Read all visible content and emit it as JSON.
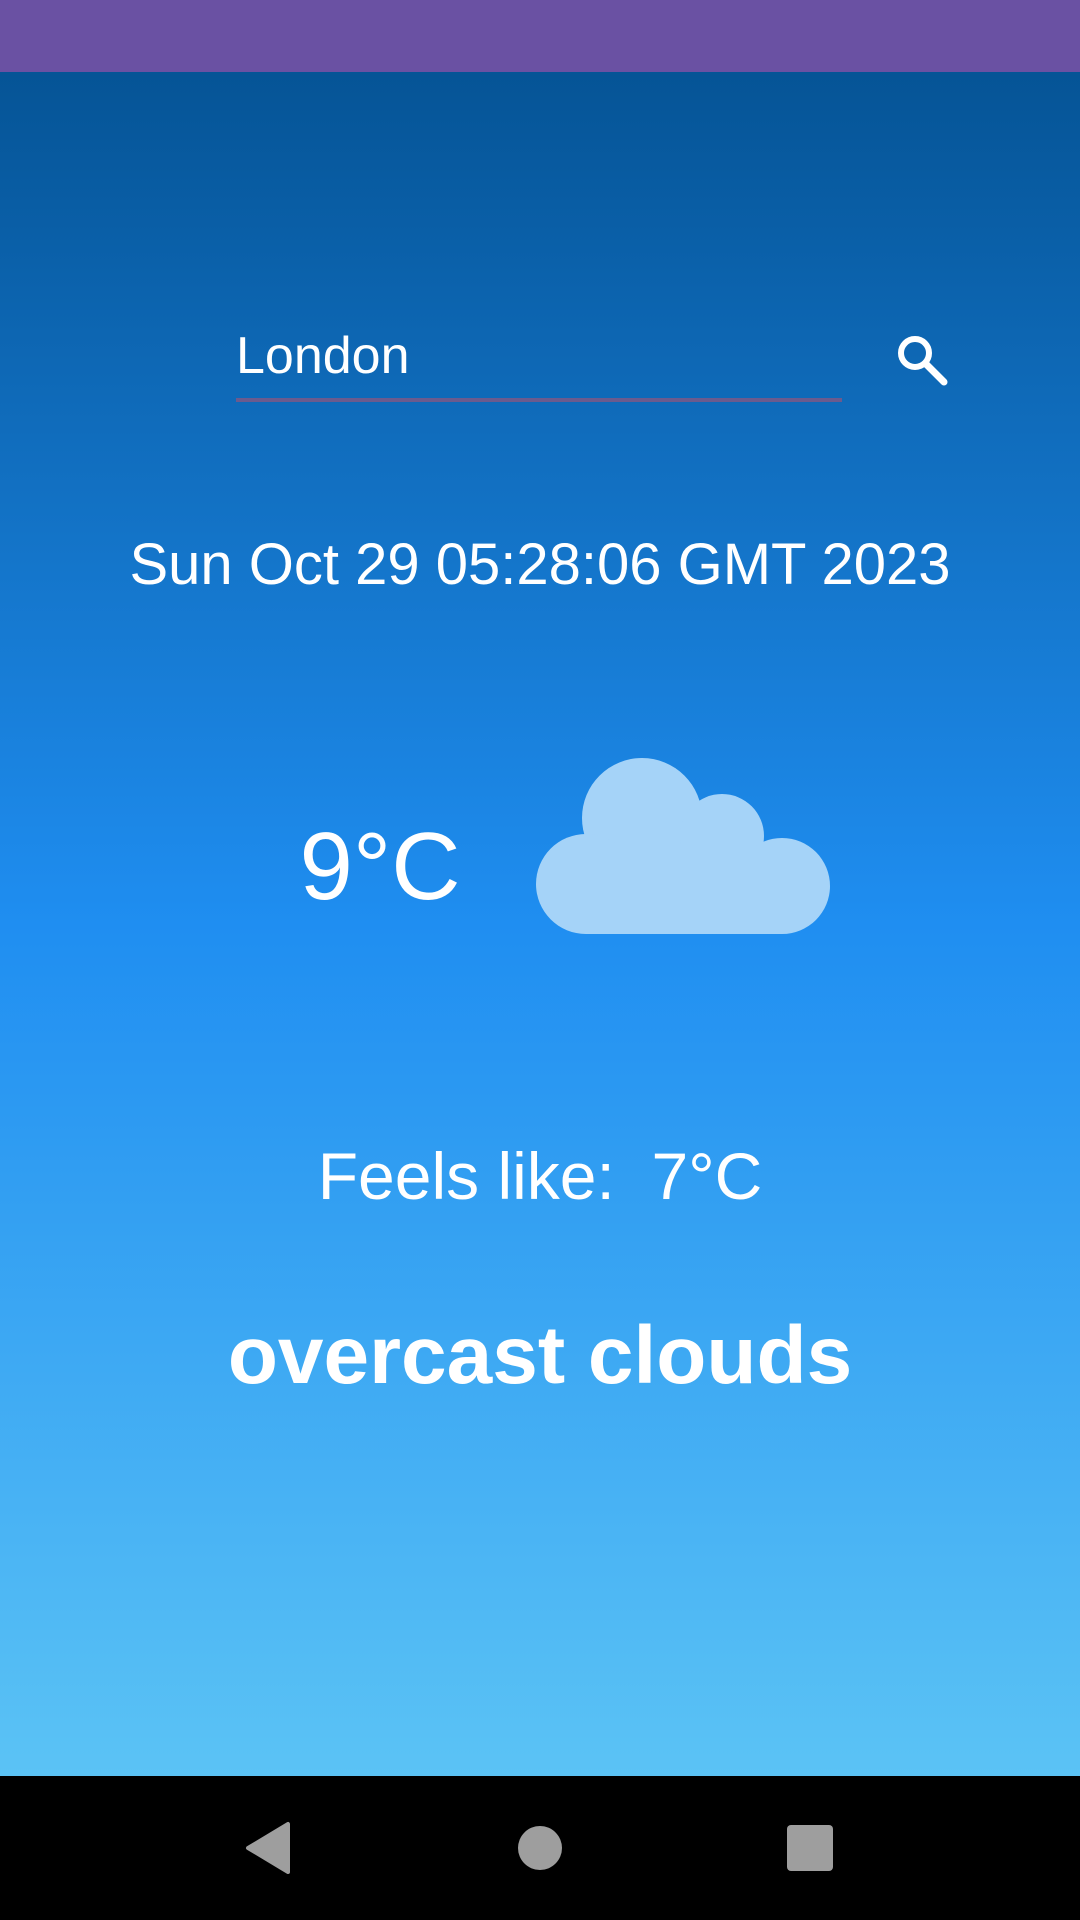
{
  "search": {
    "value": "London",
    "icon": "search-icon"
  },
  "weather": {
    "datetime": "Sun Oct 29 05:28:06 GMT 2023",
    "temperature": "9°C",
    "condition_icon": "cloud-icon",
    "feels_like_label": "Feels like:",
    "feels_like_value": "7°C",
    "description": "overcast clouds"
  },
  "nav": {
    "back_icon": "back-icon",
    "home_icon": "home-icon",
    "recents_icon": "recents-icon"
  },
  "colors": {
    "status_bar": "#6a51a3",
    "gradient_top": "#055496",
    "gradient_mid": "#1f8ef1",
    "gradient_bottom": "#5bc3f5",
    "cloud": "#a5d3f8",
    "nav_icons": "#9e9e9e"
  }
}
